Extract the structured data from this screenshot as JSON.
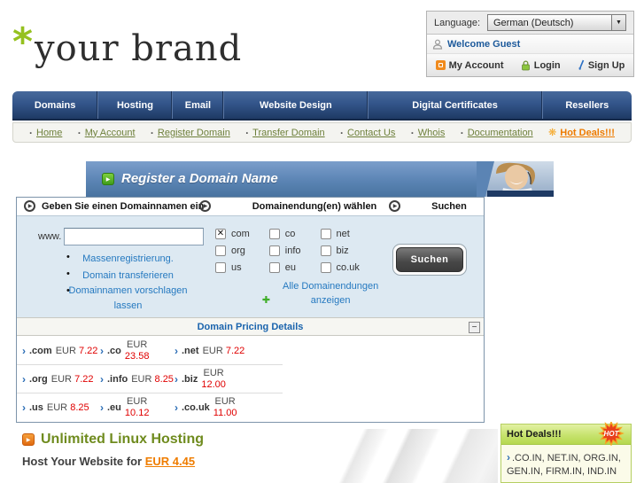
{
  "colors": {
    "brand_green": "#95c11f",
    "nav_blue_dark": "#1e3a64",
    "banner_blue": "#5b84b4",
    "link_blue": "#2579c0",
    "price_red": "#e00000",
    "accent_orange": "#ee7b00",
    "olive_green": "#6f8b1e",
    "hotdeals_green": "#b5d84e"
  },
  "logo": {
    "mark": "*",
    "name": "your brand"
  },
  "account": {
    "language_label": "Language:",
    "language_selected": "German (Deutsch)",
    "welcome": "Welcome Guest",
    "my_account": "My Account",
    "login": "Login",
    "sign_up": "Sign Up"
  },
  "main_nav": {
    "items": [
      {
        "label": "Domains"
      },
      {
        "label": "Hosting"
      },
      {
        "label": "Email"
      },
      {
        "label": "Website Design"
      },
      {
        "label": "Digital Certificates"
      },
      {
        "label": "Resellers"
      }
    ]
  },
  "secondary_nav": {
    "items": [
      {
        "label": "Home"
      },
      {
        "label": "My Account"
      },
      {
        "label": "Register Domain"
      },
      {
        "label": "Transfer Domain"
      },
      {
        "label": "Contact Us"
      },
      {
        "label": "Whois"
      },
      {
        "label": "Documentation"
      }
    ],
    "hot_deals": "Hot Deals!!!"
  },
  "banner": {
    "title": "Register a Domain Name"
  },
  "form": {
    "steps": [
      {
        "label": "Geben Sie einen Domainnamen ein"
      },
      {
        "label": "Domainendung(en) wählen"
      },
      {
        "label": "Suchen"
      }
    ],
    "www_label": "www.",
    "domain_input": {
      "value": ""
    },
    "links": [
      {
        "label": "Massenregistrierung."
      },
      {
        "label": "Domain transferieren"
      },
      {
        "label": "Domainnamen vorschlagen lassen"
      }
    ],
    "tld_columns": [
      {
        "items": [
          {
            "label": "com",
            "checked": true
          },
          {
            "label": "org",
            "checked": false
          },
          {
            "label": "us",
            "checked": false
          }
        ]
      },
      {
        "items": [
          {
            "label": "co",
            "checked": false
          },
          {
            "label": "info",
            "checked": false
          },
          {
            "label": "eu",
            "checked": false
          }
        ]
      },
      {
        "items": [
          {
            "label": "net",
            "checked": false
          },
          {
            "label": "biz",
            "checked": false
          },
          {
            "label": "co.uk",
            "checked": false
          }
        ]
      }
    ],
    "show_all": "Alle Domainendungen anzeigen",
    "search_button": "Suchen"
  },
  "pricing": {
    "title": "Domain Pricing Details",
    "collapse": "−",
    "rows": [
      {
        "cells": [
          {
            "tld": ".com",
            "currency": "EUR",
            "price": "7.22"
          },
          {
            "tld": ".co",
            "currency": "EUR",
            "price": "23.58"
          },
          {
            "tld": ".net",
            "currency": "EUR",
            "price": "7.22"
          }
        ]
      },
      {
        "cells": [
          {
            "tld": ".org",
            "currency": "EUR",
            "price": "7.22"
          },
          {
            "tld": ".info",
            "currency": "EUR",
            "price": "8.25"
          },
          {
            "tld": ".biz",
            "currency": "EUR",
            "price": "12.00"
          }
        ]
      },
      {
        "cells": [
          {
            "tld": ".us",
            "currency": "EUR",
            "price": "8.25"
          },
          {
            "tld": ".eu",
            "currency": "EUR",
            "price": "10.12"
          },
          {
            "tld": ".co.uk",
            "currency": "EUR",
            "price": "11.00"
          }
        ]
      }
    ]
  },
  "hosting_promo": {
    "title": "Unlimited Linux Hosting",
    "line": "Host Your Website for",
    "price": "EUR 4.45"
  },
  "hot_deals": {
    "title": "Hot Deals!!!",
    "badge": "HOT",
    "items": ".CO.IN, NET.IN, ORG.IN, GEN.IN, FIRM.IN, IND.IN"
  }
}
